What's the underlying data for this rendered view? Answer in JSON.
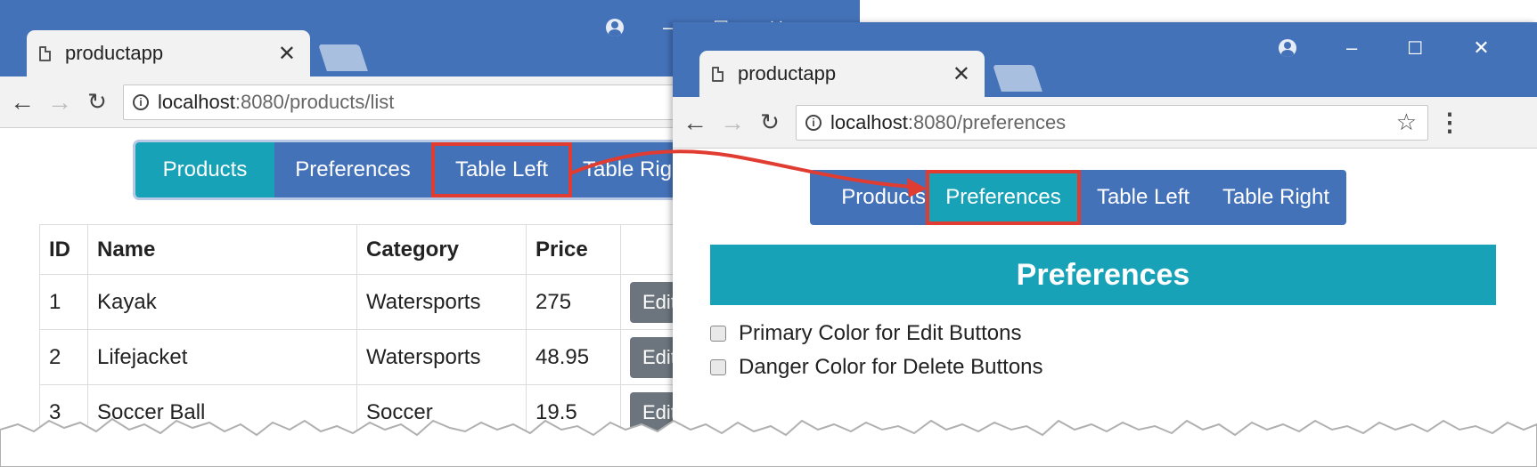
{
  "colors": {
    "chrome": "#4472b9",
    "active": "#17a2b8",
    "highlight": "#e03c31",
    "edit_button": "#6c757d"
  },
  "left_window": {
    "tab_title": "productapp",
    "url_host": "localhost",
    "url_path": ":8080/products/list",
    "nav": [
      "Products",
      "Preferences",
      "Table Left",
      "Table Right"
    ],
    "active_nav": "Products",
    "highlighted_nav": "Table Left",
    "table": {
      "headers": [
        "ID",
        "Name",
        "Category",
        "Price",
        ""
      ],
      "rows": [
        {
          "id": "1",
          "name": "Kayak",
          "category": "Watersports",
          "price": "275",
          "action": "Edit"
        },
        {
          "id": "2",
          "name": "Lifejacket",
          "category": "Watersports",
          "price": "48.95",
          "action": "Edit"
        },
        {
          "id": "3",
          "name": "Soccer Ball",
          "category": "Soccer",
          "price": "19.5",
          "action": "Edit"
        }
      ]
    }
  },
  "right_window": {
    "tab_title": "productapp",
    "url_host": "localhost",
    "url_path": ":8080/preferences",
    "nav": [
      "Products",
      "Preferences",
      "Table Left",
      "Table Right"
    ],
    "active_nav": "Preferences",
    "highlighted_nav": "Preferences",
    "heading": "Preferences",
    "options": [
      "Primary Color for Edit Buttons",
      "Danger Color for Delete Buttons"
    ]
  },
  "icons": {
    "doc": "document-icon",
    "close": "close-icon",
    "back": "back-arrow-icon",
    "forward": "forward-arrow-icon",
    "reload": "reload-icon",
    "info": "info-icon",
    "star": "bookmark-star-icon",
    "menu": "kebab-menu-icon",
    "profile": "profile-icon"
  }
}
